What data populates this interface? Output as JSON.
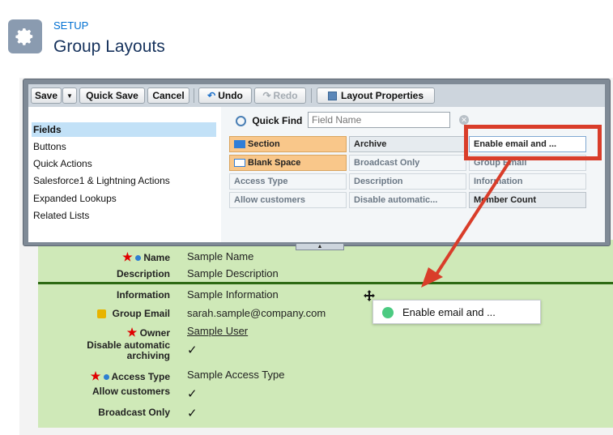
{
  "header": {
    "setup_label": "SETUP",
    "title": "Group Layouts",
    "icon": "gear-icon"
  },
  "toolbar": {
    "save": "Save",
    "quick_save": "Quick Save",
    "cancel": "Cancel",
    "undo": "Undo",
    "redo": "Redo",
    "layout_properties": "Layout Properties"
  },
  "categories": [
    {
      "label": "Fields",
      "selected": true
    },
    {
      "label": "Buttons"
    },
    {
      "label": "Quick Actions"
    },
    {
      "label": "Salesforce1 & Lightning Actions"
    },
    {
      "label": "Expanded Lookups"
    },
    {
      "label": "Related Lists"
    }
  ],
  "quick_find": {
    "label": "Quick Find",
    "placeholder": "Field Name"
  },
  "palette_fields": {
    "row1": [
      "Section",
      "Archive",
      "Enable email and ..."
    ],
    "row2": [
      "Blank Space",
      "Broadcast Only",
      "Group Email"
    ],
    "row3": [
      "Access Type",
      "Description",
      "Information"
    ],
    "row4": [
      "Allow customers",
      "Disable automatic...",
      "Member Count"
    ]
  },
  "layout_fields": [
    {
      "label": "Name",
      "value": "Sample Name",
      "required": true,
      "dot": true
    },
    {
      "label": "Description",
      "value": "Sample Description"
    },
    {
      "label": "Information",
      "value": "Sample Information"
    },
    {
      "label": "Group Email",
      "value": "sarah.sample@company.com",
      "lock": true
    },
    {
      "label": "Owner",
      "value": "Sample User",
      "required": true
    },
    {
      "label": "Disable automatic archiving",
      "value": "✓"
    },
    {
      "label": "Access Type",
      "value": "Sample Access Type",
      "required": true,
      "dot": true
    },
    {
      "label": "Allow customers",
      "value": "✓"
    },
    {
      "label": "Broadcast Only",
      "value": "✓"
    }
  ],
  "drag_tooltip": "Enable email and ...",
  "colors": {
    "accent": "#0070d2",
    "highlight": "#d93d2a",
    "layout_green": "#cfe9b8",
    "section_orange": "#f9c78a"
  }
}
